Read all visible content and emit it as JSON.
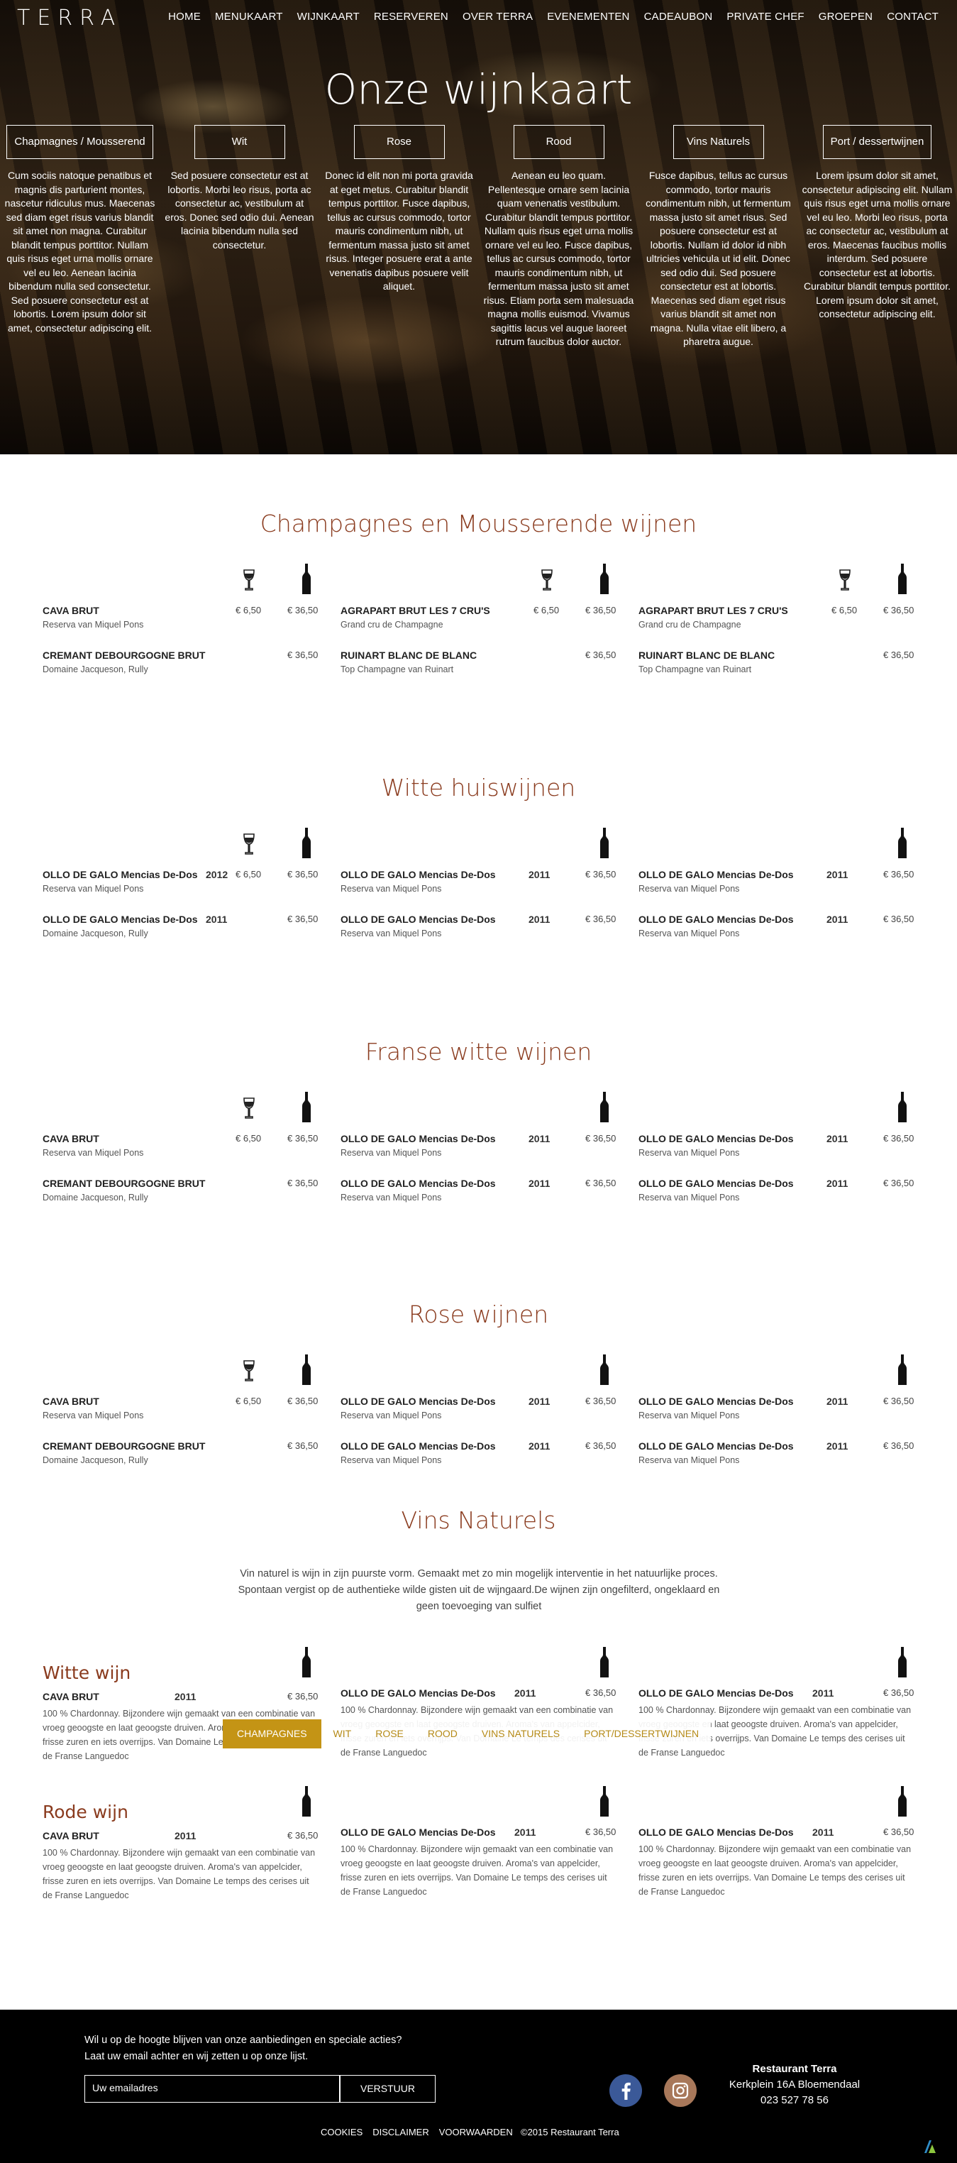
{
  "header": {
    "logo": "TERRA",
    "nav": [
      "HOME",
      "MENUKAART",
      "WIJNKAART",
      "RESERVEREN",
      "OVER TERRA",
      "EVENEMENTEN",
      "CADEAUBON",
      "PRIVATE CHEF",
      "GROEPEN",
      "CONTACT"
    ]
  },
  "hero": {
    "title": "Onze wijnkaart",
    "categories": [
      {
        "label": "Chapmagnes / Mousserend",
        "text": "Cum sociis natoque penatibus et magnis dis parturient montes, nascetur ridiculus mus. Maecenas sed diam eget risus varius blandit sit amet non magna. Curabitur blandit tempus porttitor. Nullam quis risus eget urna mollis ornare vel eu leo. Aenean lacinia bibendum nulla sed consectetur. Sed posuere consectetur est at lobortis. Lorem ipsum dolor sit amet, consectetur adipiscing elit."
      },
      {
        "label": "Wit",
        "text": "Sed posuere consectetur est at lobortis. Morbi leo risus, porta ac consectetur ac, vestibulum at eros. Donec sed odio dui. Aenean lacinia bibendum nulla sed consectetur."
      },
      {
        "label": "Rose",
        "text": "Donec id elit non mi porta gravida at eget metus. Curabitur blandit tempus porttitor. Fusce dapibus, tellus ac cursus commodo, tortor mauris condimentum nibh, ut fermentum massa justo sit amet risus. Integer posuere erat a ante venenatis dapibus posuere velit aliquet."
      },
      {
        "label": "Rood",
        "text": "Aenean eu leo quam. Pellentesque ornare sem lacinia quam venenatis vestibulum. Curabitur blandit tempus porttitor. Nullam quis risus eget urna mollis ornare vel eu leo. Fusce dapibus, tellus ac cursus commodo, tortor mauris condimentum nibh, ut fermentum massa justo sit amet risus. Etiam porta sem malesuada magna mollis euismod. Vivamus sagittis lacus vel augue laoreet rutrum faucibus dolor auctor."
      },
      {
        "label": "Vins Naturels",
        "text": "Fusce dapibus, tellus ac cursus commodo, tortor mauris condimentum nibh, ut fermentum massa justo sit amet risus. Sed posuere consectetur est at lobortis. Nullam id dolor id nibh ultricies vehicula ut id elit. Donec sed odio dui. Sed posuere consectetur est at lobortis. Maecenas sed diam eget risus varius blandit sit amet non magna. Nulla vitae elit libero, a pharetra augue."
      },
      {
        "label": "Port / dessertwijnen",
        "text": "Lorem ipsum dolor sit amet, consectetur adipiscing elit. Nullam quis risus eget urna mollis ornare vel eu leo. Morbi leo risus, porta ac consectetur ac, vestibulum at eros. Maecenas faucibus mollis interdum. Sed posuere consectetur est at lobortis. Curabitur blandit tempus porttitor. Lorem ipsum dolor sit amet, consectetur adipiscing elit."
      }
    ]
  },
  "sections": [
    {
      "title": "Champagnes en Mousserende wijnen",
      "columns": [
        {
          "glass": true,
          "items": [
            {
              "name": "CAVA BRUT",
              "sub": "Reserva van Miquel Pons",
              "year": "",
              "glass_price": "€ 6,50",
              "bottle_price": "€ 36,50"
            },
            {
              "name": "CREMANT DEBOURGOGNE BRUT",
              "sub": "Domaine Jacqueson, Rully",
              "year": "",
              "glass_price": "",
              "bottle_price": "€ 36,50"
            }
          ]
        },
        {
          "glass": true,
          "items": [
            {
              "name": "AGRAPART BRUT LES 7 CRU'S",
              "sub": "Grand cru de Champagne",
              "year": "",
              "glass_price": "€ 6,50",
              "bottle_price": "€ 36,50"
            },
            {
              "name": "RUINART BLANC DE BLANC",
              "sub": "Top Champagne van Ruinart",
              "year": "",
              "glass_price": "",
              "bottle_price": "€ 36,50"
            }
          ]
        },
        {
          "glass": true,
          "items": [
            {
              "name": "AGRAPART BRUT LES 7 CRU'S",
              "sub": "Grand cru de Champagne",
              "year": "",
              "glass_price": "€ 6,50",
              "bottle_price": "€ 36,50"
            },
            {
              "name": "RUINART BLANC DE BLANC",
              "sub": "Top Champagne van Ruinart",
              "year": "",
              "glass_price": "",
              "bottle_price": "€ 36,50"
            }
          ]
        }
      ]
    },
    {
      "title": "Witte huiswijnen",
      "columns": [
        {
          "glass": true,
          "items": [
            {
              "name": "OLLO DE GALO Mencias De-Dos",
              "sub": "Reserva van Miquel Pons",
              "year": "2012",
              "glass_price": "€ 6,50",
              "bottle_price": "€ 36,50"
            },
            {
              "name": "OLLO DE GALO Mencias De-Dos",
              "sub": "Domaine Jacqueson, Rully",
              "year": "2011",
              "glass_price": "",
              "bottle_price": "€ 36,50"
            }
          ]
        },
        {
          "glass": false,
          "items": [
            {
              "name": "OLLO DE GALO Mencias De-Dos",
              "sub": "Reserva van Miquel Pons",
              "year": "2011",
              "glass_price": "",
              "bottle_price": "€ 36,50"
            },
            {
              "name": "OLLO DE GALO Mencias De-Dos",
              "sub": "Reserva van Miquel Pons",
              "year": "2011",
              "glass_price": "",
              "bottle_price": "€ 36,50"
            }
          ]
        },
        {
          "glass": false,
          "items": [
            {
              "name": "OLLO DE GALO Mencias De-Dos",
              "sub": "Reserva van Miquel Pons",
              "year": "2011",
              "glass_price": "",
              "bottle_price": "€ 36,50"
            },
            {
              "name": "OLLO DE GALO Mencias De-Dos",
              "sub": "Reserva van Miquel Pons",
              "year": "2011",
              "glass_price": "",
              "bottle_price": "€ 36,50"
            }
          ]
        }
      ]
    },
    {
      "title": "Franse witte wijnen",
      "columns": [
        {
          "glass": true,
          "items": [
            {
              "name": "CAVA BRUT",
              "sub": "Reserva van Miquel Pons",
              "year": "",
              "glass_price": "€ 6,50",
              "bottle_price": "€ 36,50"
            },
            {
              "name": "CREMANT DEBOURGOGNE BRUT",
              "sub": "Domaine Jacqueson, Rully",
              "year": "",
              "glass_price": "",
              "bottle_price": "€ 36,50"
            }
          ]
        },
        {
          "glass": false,
          "items": [
            {
              "name": "OLLO DE GALO Mencias De-Dos",
              "sub": "Reserva van Miquel Pons",
              "year": "2011",
              "glass_price": "",
              "bottle_price": "€ 36,50"
            },
            {
              "name": "OLLO DE GALO Mencias De-Dos",
              "sub": "Reserva van Miquel Pons",
              "year": "2011",
              "glass_price": "",
              "bottle_price": "€ 36,50"
            }
          ]
        },
        {
          "glass": false,
          "items": [
            {
              "name": "OLLO DE GALO Mencias De-Dos",
              "sub": "Reserva van Miquel Pons",
              "year": "2011",
              "glass_price": "",
              "bottle_price": "€ 36,50"
            },
            {
              "name": "OLLO DE GALO Mencias De-Dos",
              "sub": "Reserva van Miquel Pons",
              "year": "2011",
              "glass_price": "",
              "bottle_price": "€ 36,50"
            }
          ]
        }
      ]
    },
    {
      "title": "Rose wijnen",
      "columns": [
        {
          "glass": true,
          "items": [
            {
              "name": "CAVA BRUT",
              "sub": "Reserva van Miquel Pons",
              "year": "",
              "glass_price": "€ 6,50",
              "bottle_price": "€ 36,50"
            },
            {
              "name": "CREMANT DEBOURGOGNE BRUT",
              "sub": "Domaine Jacqueson, Rully",
              "year": "",
              "glass_price": "",
              "bottle_price": "€ 36,50"
            }
          ]
        },
        {
          "glass": false,
          "items": [
            {
              "name": "OLLO DE GALO Mencias De-Dos",
              "sub": "Reserva van Miquel Pons",
              "year": "2011",
              "glass_price": "",
              "bottle_price": "€ 36,50"
            },
            {
              "name": "OLLO DE GALO Mencias De-Dos",
              "sub": "Reserva van Miquel Pons",
              "year": "2011",
              "glass_price": "",
              "bottle_price": "€ 36,50"
            }
          ]
        },
        {
          "glass": false,
          "items": [
            {
              "name": "OLLO DE GALO Mencias De-Dos",
              "sub": "Reserva van Miquel Pons",
              "year": "2011",
              "glass_price": "",
              "bottle_price": "€ 36,50"
            },
            {
              "name": "OLLO DE GALO Mencias De-Dos",
              "sub": "Reserva van Miquel Pons",
              "year": "2011",
              "glass_price": "",
              "bottle_price": "€ 36,50"
            }
          ]
        }
      ]
    }
  ],
  "vins_naturels": {
    "title": "Vins Naturels",
    "intro": "Vin naturel is wijn in zijn puurste vorm. Gemaakt met zo min mogelijk interventie in het natuurlijke proces. Spontaan vergist op de authentieke wilde gisten uit de wijngaard.De wijnen zijn ongefilterd, ongeklaard en geen toevoeging van sulfiet",
    "groups": [
      {
        "heading": "Witte wijn",
        "items": [
          {
            "name": "CAVA BRUT",
            "year": "2011",
            "price": "€ 36,50",
            "desc": "100 % Chardonnay. Bijzondere wijn gemaakt van een combinatie van vroeg geoogste en laat geoogste druiven. Aroma's van appelcider, frisse zuren en iets overrijps. Van Domaine Le temps des cerises uit de Franse Languedoc"
          },
          {
            "name": "OLLO DE GALO Mencias De-Dos",
            "year": "2011",
            "price": "€ 36,50",
            "desc": "100 % Chardonnay. Bijzondere wijn gemaakt van een combinatie van vroeg geoogste en laat geoogste druiven. Aroma's van appelcider, frisse zuren en iets overrijps. Van Domaine Le temps des cerises uit de Franse Languedoc"
          },
          {
            "name": "OLLO DE GALO Mencias De-Dos",
            "year": "2011",
            "price": "€ 36,50",
            "desc": "100 % Chardonnay. Bijzondere wijn gemaakt van een combinatie van vroeg geoogste en laat geoogste druiven. Aroma's van appelcider, frisse zuren en iets overrijps. Van Domaine Le temps des cerises uit de Franse Languedoc"
          }
        ]
      },
      {
        "heading": "Rode wijn",
        "items": [
          {
            "name": "CAVA BRUT",
            "year": "2011",
            "price": "€ 36,50",
            "desc": "100 % Chardonnay. Bijzondere wijn gemaakt van een combinatie van vroeg geoogste en laat geoogste druiven. Aroma's van appelcider, frisse zuren en iets overrijps. Van Domaine Le temps des cerises uit de Franse Languedoc"
          },
          {
            "name": "OLLO DE GALO Mencias De-Dos",
            "year": "2011",
            "price": "€ 36,50",
            "desc": "100 % Chardonnay. Bijzondere wijn gemaakt van een combinatie van vroeg geoogste en laat geoogste druiven. Aroma's van appelcider, frisse zuren en iets overrijps. Van Domaine Le temps des cerises uit de Franse Languedoc"
          },
          {
            "name": "OLLO DE GALO Mencias De-Dos",
            "year": "2011",
            "price": "€ 36,50",
            "desc": "100 % Chardonnay. Bijzondere wijn gemaakt van een combinatie van vroeg geoogste en laat geoogste druiven. Aroma's van appelcider, frisse zuren en iets overrijps. Van Domaine Le temps des cerises uit de Franse Languedoc"
          }
        ]
      }
    ]
  },
  "floating_nav": {
    "active": "CHAMPAGNES",
    "items": [
      "CHAMPAGNES",
      "WIT",
      "ROSE",
      "ROOD",
      "VINS NATURELS",
      "PORT/DESSERTWIJNEN"
    ],
    "active_color": "#c49415",
    "text_color": "#b58a17"
  },
  "footer": {
    "newsletter_line1": "Wil u op de hoogte blijven van onze aanbiedingen en speciale acties?",
    "newsletter_line2": "Laat uw email achter en wij zetten u op onze lijst.",
    "email_placeholder": "Uw emailadres",
    "send_label": "VERSTUUR",
    "restaurant_name": "Restaurant Terra",
    "address": "Kerkplein 16A Bloemendaal",
    "phone": "023 527 78 56",
    "links": [
      "COOKIES",
      "DISCLAIMER",
      "VOORWAARDEN"
    ],
    "copyright": "©2015 Restaurant Terra",
    "social": [
      "facebook-icon",
      "instagram-icon"
    ]
  },
  "colors": {
    "title": "#8a3b1e",
    "accent": "#c49415",
    "facebook": "#3b5998",
    "instagram": "#a8785a"
  }
}
